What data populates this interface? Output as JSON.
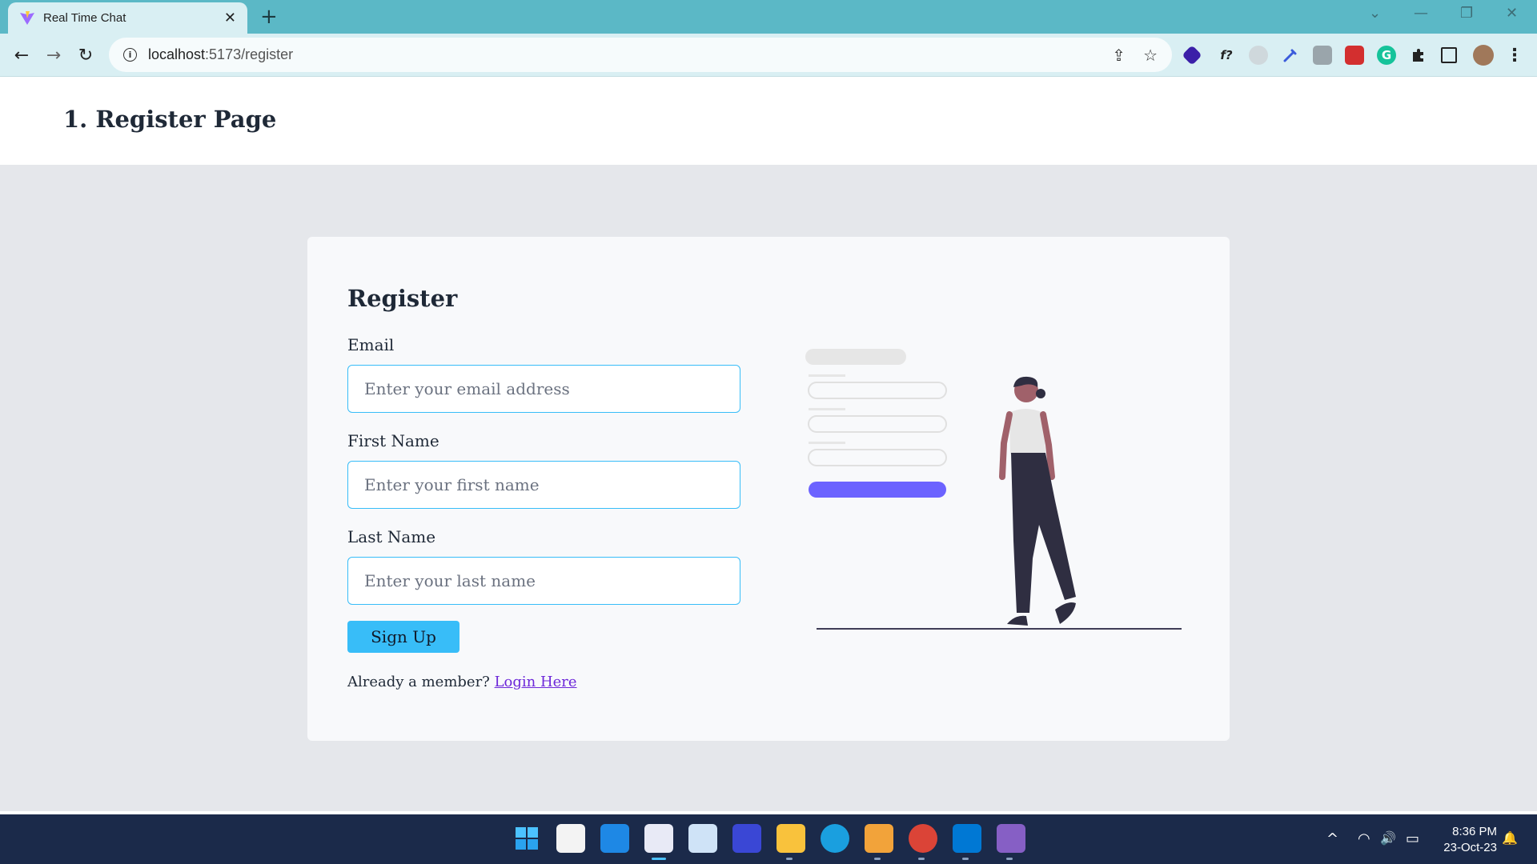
{
  "browser": {
    "tab_title": "Real Time Chat",
    "tab_close": "✕",
    "new_tab": "+",
    "url_host": "localhost",
    "url_path": ":5173/register",
    "back": "←",
    "forward": "→",
    "reload": "↻",
    "info": "i",
    "window_controls": {
      "dropdown": "⌄",
      "minimize": "—",
      "restore": "❐",
      "close": "✕"
    },
    "omnibox_icons": {
      "share": "⇪",
      "bookmark": "☆"
    },
    "extension_labels": {
      "formula": "f?",
      "grammarly": "G"
    },
    "menu": "⋮"
  },
  "page": {
    "title": "1. Register Page"
  },
  "form": {
    "heading": "Register",
    "fields": [
      {
        "label": "Email",
        "placeholder": "Enter your email address"
      },
      {
        "label": "First Name",
        "placeholder": "Enter your first name"
      },
      {
        "label": "Last Name",
        "placeholder": "Enter your last name"
      }
    ],
    "submit_label": "Sign Up",
    "member_text": "Already a member?",
    "login_link": "Login Here"
  },
  "colors": {
    "accent": "#38bdf8",
    "illustration_primary": "#6c63ff",
    "link": "#6d28d9",
    "page_bg": "#e5e7eb"
  },
  "taskbar": {
    "time": "8:36 PM",
    "date": "23-Oct-23",
    "apps": [
      "windows-start",
      "microsoft-store",
      "mail",
      "snipping-tool",
      "resource-monitor",
      "azure-data-studio",
      "file-explorer",
      "edge",
      "mail-utility",
      "chrome",
      "vscode",
      "visual-studio"
    ],
    "tray_glyphs": {
      "chevron": "^",
      "wifi": "◠",
      "volume": "🔊",
      "battery": "▭",
      "notification": "🔔"
    }
  }
}
